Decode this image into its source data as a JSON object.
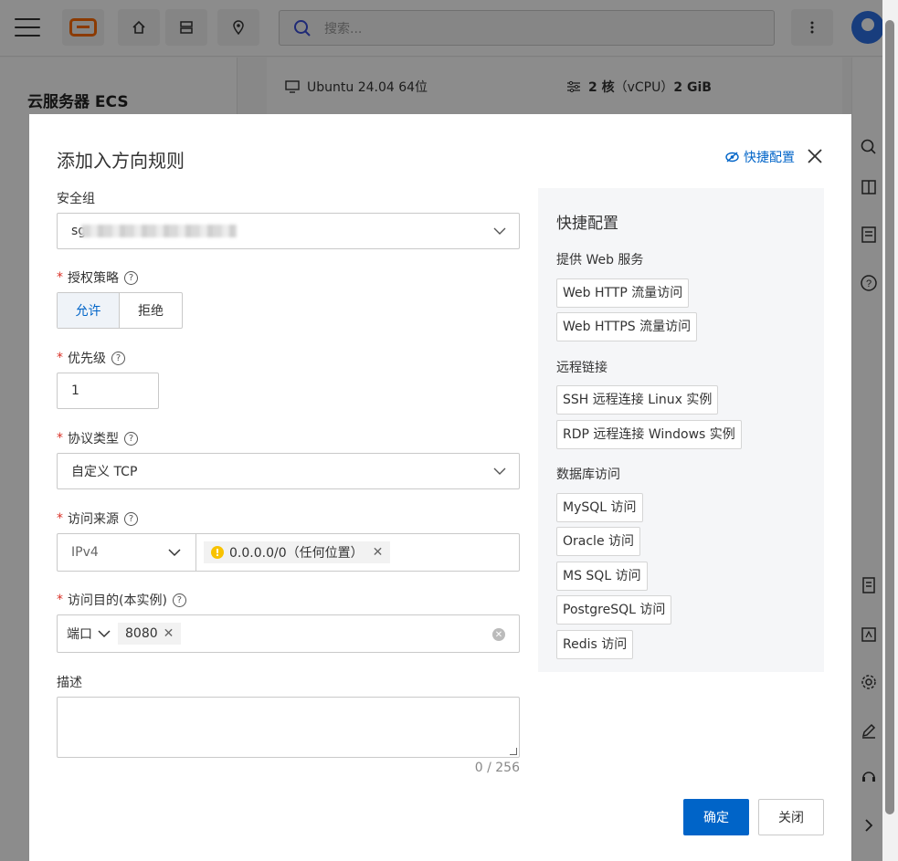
{
  "topbar": {
    "search_placeholder": "搜索..."
  },
  "background": {
    "page_title": "云服务器 ECS",
    "os": "Ubuntu 24.04 64位",
    "spec_cores": "2 核",
    "spec_vcpu": "（vCPU）",
    "spec_mem": "2 GiB"
  },
  "dialog": {
    "title": "添加入方向规则",
    "quick_config_link": "快捷配置",
    "security_group_label": "安全组",
    "security_group_value_prefix": "sg",
    "auth_policy_label": "授权策略",
    "auth_allow": "允许",
    "auth_deny": "拒绝",
    "priority_label": "优先级",
    "priority_value": "1",
    "protocol_label": "协议类型",
    "protocol_value": "自定义 TCP",
    "source_label": "访问来源",
    "source_ip_version": "IPv4",
    "source_tag": "0.0.0.0/0（任何位置）",
    "dest_label": "访问目的(本实例)",
    "dest_type": "端口",
    "dest_tag": "8080",
    "desc_label": "描述",
    "desc_counter": "0 / 256",
    "confirm_button": "确定",
    "close_button": "关闭",
    "accent_color": "#0064c8",
    "required_color": "#d93026"
  },
  "quick_panel": {
    "title": "快捷配置",
    "sections": [
      {
        "title": "提供 Web 服务",
        "items": [
          "Web HTTP 流量访问",
          "Web HTTPS 流量访问"
        ]
      },
      {
        "title": "远程链接",
        "items": [
          "SSH 远程连接 Linux 实例",
          "RDP 远程连接 Windows 实例"
        ]
      },
      {
        "title": "数据库访问",
        "items": [
          "MySQL 访问",
          "Oracle 访问",
          "MS SQL 访问",
          "PostgreSQL 访问",
          "Redis 访问"
        ]
      }
    ]
  }
}
